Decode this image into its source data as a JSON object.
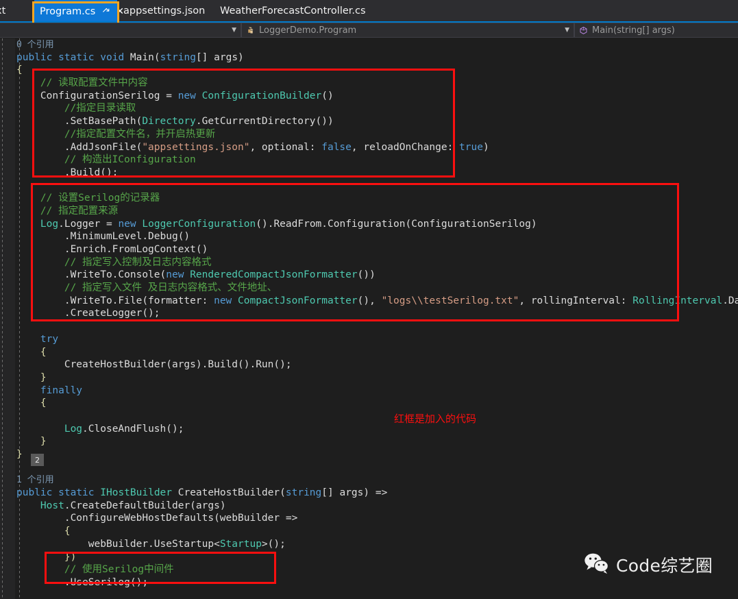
{
  "tabs": [
    {
      "label": "xt",
      "state": "clipped"
    },
    {
      "label": "Program.cs",
      "state": "active",
      "pin_icon": "pin-icon",
      "close_icon": "close-icon"
    },
    {
      "label": "appsettings.json",
      "state": "inactive"
    },
    {
      "label": "WeatherForecastController.cs",
      "state": "inactive"
    }
  ],
  "navbar": {
    "project_caret_icon": "chevron-down-icon",
    "type_icon": "class-icon",
    "type_name": "LoggerDemo.Program",
    "type_caret_icon": "chevron-down-icon",
    "member_icon": "method-icon",
    "member_name": "Main(string[] args)"
  },
  "codelens": {
    "main": "0 个引用",
    "createhostbuilder": "1 个引用",
    "hover_badge": "2"
  },
  "annotations": {
    "note": "红框是加入的代码",
    "note_color": "#fb0f0f",
    "box_color": "#fb0f0f",
    "tab_box_color": "#f5a623"
  },
  "watermark": {
    "icon": "wechat-icon",
    "text": "Code综艺圈"
  },
  "code": {
    "lines": [
      [
        {
          "t": "0 个引用",
          "c": "codelens"
        }
      ],
      [
        {
          "t": "public",
          "c": "kw"
        },
        {
          "t": " ",
          "c": "pln"
        },
        {
          "t": "static",
          "c": "kw"
        },
        {
          "t": " ",
          "c": "pln"
        },
        {
          "t": "void",
          "c": "kw"
        },
        {
          "t": " Main",
          "c": "pln"
        },
        {
          "t": "(",
          "c": "pln"
        },
        {
          "t": "string",
          "c": "kw"
        },
        {
          "t": "[] args)",
          "c": "pln"
        }
      ],
      [
        {
          "t": "{",
          "c": "cls"
        }
      ],
      [
        {
          "t": "    ",
          "c": "pln"
        },
        {
          "t": "// 读取配置文件中内容",
          "c": "cmt"
        }
      ],
      [
        {
          "t": "    ConfigurationSerilog = ",
          "c": "pln"
        },
        {
          "t": "new",
          "c": "kw"
        },
        {
          "t": " ",
          "c": "pln"
        },
        {
          "t": "ConfigurationBuilder",
          "c": "typ"
        },
        {
          "t": "()",
          "c": "pln"
        }
      ],
      [
        {
          "t": "        ",
          "c": "pln"
        },
        {
          "t": "//指定目录读取",
          "c": "cmt"
        }
      ],
      [
        {
          "t": "        .SetBasePath(",
          "c": "pln"
        },
        {
          "t": "Directory",
          "c": "typ"
        },
        {
          "t": ".GetCurrentDirectory())",
          "c": "pln"
        }
      ],
      [
        {
          "t": "        ",
          "c": "pln"
        },
        {
          "t": "//指定配置文件名，并开启热更新",
          "c": "cmt"
        }
      ],
      [
        {
          "t": "        .AddJsonFile(",
          "c": "pln"
        },
        {
          "t": "\"appsettings.json\"",
          "c": "str"
        },
        {
          "t": ", optional: ",
          "c": "pln"
        },
        {
          "t": "false",
          "c": "kw"
        },
        {
          "t": ", reloadOnChange: ",
          "c": "pln"
        },
        {
          "t": "true",
          "c": "kw"
        },
        {
          "t": ")",
          "c": "pln"
        }
      ],
      [
        {
          "t": "        ",
          "c": "pln"
        },
        {
          "t": "// 构造出IConfiguration",
          "c": "cmt"
        }
      ],
      [
        {
          "t": "        .Build();",
          "c": "pln"
        }
      ],
      [
        {
          "t": "",
          "c": "pln"
        }
      ],
      [
        {
          "t": "    ",
          "c": "pln"
        },
        {
          "t": "// 设置Serilog的记录器",
          "c": "cmt"
        }
      ],
      [
        {
          "t": "    ",
          "c": "pln"
        },
        {
          "t": "// 指定配置来源",
          "c": "cmt"
        }
      ],
      [
        {
          "t": "    ",
          "c": "pln"
        },
        {
          "t": "Log",
          "c": "typ"
        },
        {
          "t": ".Logger = ",
          "c": "pln"
        },
        {
          "t": "new",
          "c": "kw"
        },
        {
          "t": " ",
          "c": "pln"
        },
        {
          "t": "LoggerConfiguration",
          "c": "typ"
        },
        {
          "t": "().ReadFrom.Configuration(ConfigurationSerilog)",
          "c": "pln"
        }
      ],
      [
        {
          "t": "        .MinimumLevel.Debug()",
          "c": "pln"
        }
      ],
      [
        {
          "t": "        .Enrich.FromLogContext()",
          "c": "pln"
        }
      ],
      [
        {
          "t": "        ",
          "c": "pln"
        },
        {
          "t": "// 指定写入控制及日志内容格式",
          "c": "cmt"
        }
      ],
      [
        {
          "t": "        .WriteTo.Console(",
          "c": "pln"
        },
        {
          "t": "new",
          "c": "kw"
        },
        {
          "t": " ",
          "c": "pln"
        },
        {
          "t": "RenderedCompactJsonFormatter",
          "c": "typ"
        },
        {
          "t": "())",
          "c": "pln"
        }
      ],
      [
        {
          "t": "        ",
          "c": "pln"
        },
        {
          "t": "// 指定写入文件 及日志内容格式、文件地址、",
          "c": "cmt"
        }
      ],
      [
        {
          "t": "        .WriteTo.File(formatter: ",
          "c": "pln"
        },
        {
          "t": "new",
          "c": "kw"
        },
        {
          "t": " ",
          "c": "pln"
        },
        {
          "t": "CompactJsonFormatter",
          "c": "typ"
        },
        {
          "t": "(), ",
          "c": "pln"
        },
        {
          "t": "\"logs\\\\testSerilog.txt\"",
          "c": "str"
        },
        {
          "t": ", rollingInterval: ",
          "c": "pln"
        },
        {
          "t": "RollingInterval",
          "c": "typ"
        },
        {
          "t": ".Day)",
          "c": "pln"
        }
      ],
      [
        {
          "t": "        .CreateLogger();",
          "c": "pln"
        }
      ],
      [
        {
          "t": "",
          "c": "pln"
        }
      ],
      [
        {
          "t": "    ",
          "c": "pln"
        },
        {
          "t": "try",
          "c": "kw"
        }
      ],
      [
        {
          "t": "    {",
          "c": "cls"
        }
      ],
      [
        {
          "t": "        CreateHostBuilder(args).Build().Run();",
          "c": "pln"
        }
      ],
      [
        {
          "t": "    }",
          "c": "cls"
        }
      ],
      [
        {
          "t": "    ",
          "c": "pln"
        },
        {
          "t": "finally",
          "c": "kw"
        }
      ],
      [
        {
          "t": "    {",
          "c": "cls"
        }
      ],
      [
        {
          "t": "",
          "c": "pln"
        }
      ],
      [
        {
          "t": "        ",
          "c": "pln"
        },
        {
          "t": "Log",
          "c": "typ"
        },
        {
          "t": ".CloseAndFlush();",
          "c": "pln"
        }
      ],
      [
        {
          "t": "    }",
          "c": "cls"
        }
      ],
      [
        {
          "t": "}",
          "c": "cls"
        }
      ],
      [
        {
          "t": "",
          "c": "pln"
        }
      ],
      [
        {
          "t": "1 个引用",
          "c": "codelens"
        }
      ],
      [
        {
          "t": "public",
          "c": "kw"
        },
        {
          "t": " ",
          "c": "pln"
        },
        {
          "t": "static",
          "c": "kw"
        },
        {
          "t": " ",
          "c": "pln"
        },
        {
          "t": "IHostBuilder",
          "c": "typ"
        },
        {
          "t": " CreateHostBuilder(",
          "c": "pln"
        },
        {
          "t": "string",
          "c": "kw"
        },
        {
          "t": "[] args) =>",
          "c": "pln"
        }
      ],
      [
        {
          "t": "    ",
          "c": "pln"
        },
        {
          "t": "Host",
          "c": "typ"
        },
        {
          "t": ".CreateDefaultBuilder(args)",
          "c": "pln"
        }
      ],
      [
        {
          "t": "        .ConfigureWebHostDefaults(webBuilder =>",
          "c": "pln"
        }
      ],
      [
        {
          "t": "        {",
          "c": "cls"
        }
      ],
      [
        {
          "t": "            webBuilder.UseStartup<",
          "c": "pln"
        },
        {
          "t": "Startup",
          "c": "typ"
        },
        {
          "t": ">();",
          "c": "pln"
        }
      ],
      [
        {
          "t": "        })",
          "c": "cls"
        }
      ],
      [
        {
          "t": "        ",
          "c": "pln"
        },
        {
          "t": "// 使用Serilog中间件",
          "c": "cmt"
        }
      ],
      [
        {
          "t": "        .UseSerilog();",
          "c": "pln"
        }
      ]
    ]
  }
}
